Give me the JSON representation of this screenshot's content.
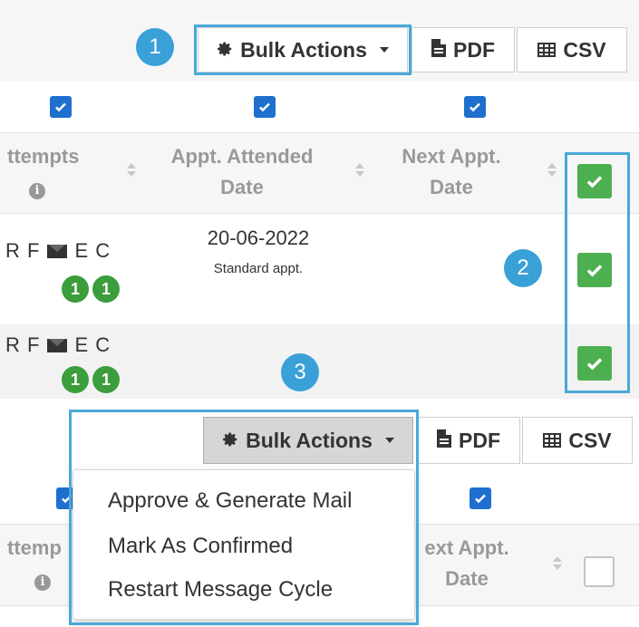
{
  "top": {
    "toolbar": {
      "bulk_actions_label": "Bulk Actions",
      "pdf_label": "PDF",
      "csv_label": "CSV"
    },
    "columns": {
      "attempts": "ttempts",
      "appt_attended": "Appt. Attended\nDate",
      "next_appt": "Next Appt.\nDate"
    },
    "rows": [
      {
        "letters_a": "R F",
        "letters_b": "E C",
        "count_1": "1",
        "count_2": "1",
        "date": "20-06-2022",
        "appt_type": "Standard appt."
      },
      {
        "letters_a": "R F",
        "letters_b": "E C",
        "count_1": "1",
        "count_2": "1"
      }
    ]
  },
  "annotations": {
    "step1": "1",
    "step2": "2",
    "step3": "3"
  },
  "bottom": {
    "toolbar": {
      "bulk_actions_label": "Bulk Actions",
      "pdf_label": "PDF",
      "csv_label": "CSV"
    },
    "menu": {
      "items": [
        "Approve & Generate Mail",
        "Mark As Confirmed",
        "Restart Message Cycle"
      ]
    },
    "columns": {
      "attempts": "ttemp",
      "next_appt": "ext Appt.\nDate"
    }
  },
  "colors": {
    "highlight": "#4aa8d8",
    "badge": "#3aa0d8",
    "checkbox_blue": "#1f6fcf",
    "checkbox_green": "#4caf50",
    "count_green": "#3c9d3c"
  },
  "icons": [
    "gear-icon",
    "file-icon",
    "table-icon",
    "check-icon",
    "envelope-icon",
    "info-icon",
    "sort-icon",
    "caret-down-icon"
  ]
}
